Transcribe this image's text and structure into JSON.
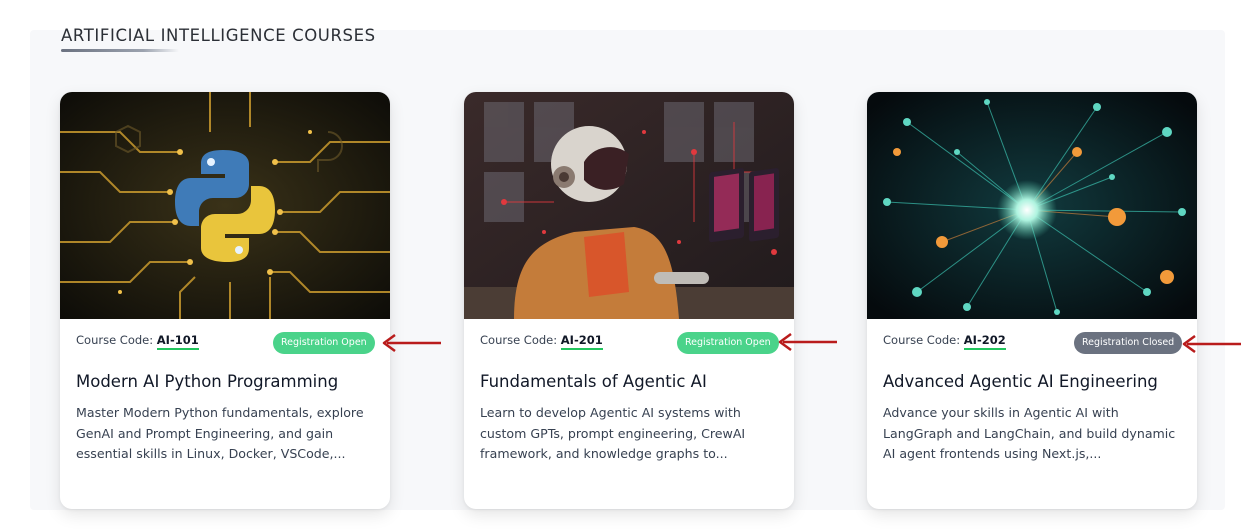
{
  "section": {
    "title": "ARTIFICIAL INTELLIGENCE COURSES"
  },
  "courses": [
    {
      "code_label": "Course Code:",
      "code": "AI-101",
      "status": "Registration Open",
      "title": "Modern AI Python Programming",
      "description": "Master Modern Python fundamentals, explore GenAI and Prompt Engineering, and gain essential skills in Linux, Docker, VSCode,..."
    },
    {
      "code_label": "Course Code:",
      "code": "AI-201",
      "status": "Registration Open",
      "title": "Fundamentals of Agentic AI",
      "description": "Learn to develop Agentic AI systems with custom GPTs, prompt engineering, CrewAI framework, and knowledge graphs to..."
    },
    {
      "code_label": "Course Code:",
      "code": "AI-202",
      "status": "Registration Closed",
      "title": "Advanced Agentic AI Engineering",
      "description": "Advance your skills in Agentic AI with LangGraph and LangChain, and build dynamic AI agent frontends using Next.js,..."
    }
  ],
  "colors": {
    "badge_open": "#4ad38a",
    "badge_closed": "#6b7280",
    "annotation_arrow": "#b91c1c"
  },
  "icons": {
    "card1_image": "python-logo-circuit-image",
    "card2_image": "robot-at-computer-image",
    "card3_image": "neural-network-image",
    "annotation": "red-arrow-left-icon"
  }
}
